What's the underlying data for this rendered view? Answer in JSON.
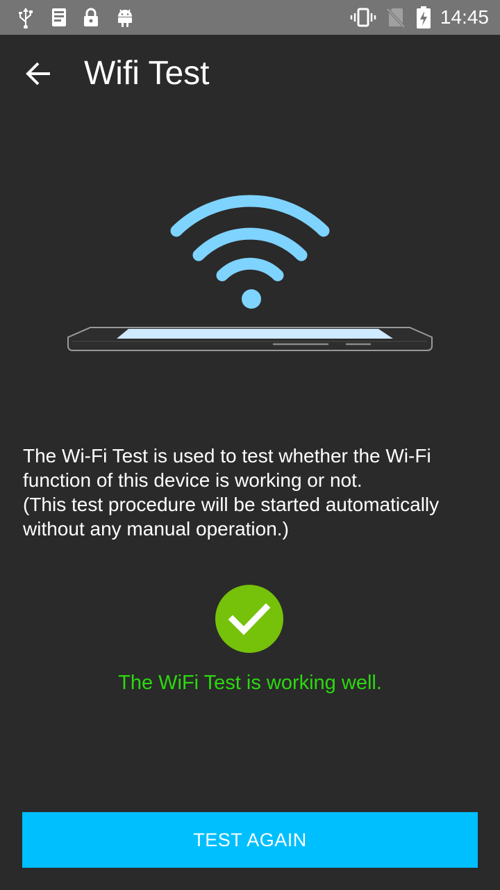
{
  "status_bar": {
    "left_icons": [
      "usb-icon",
      "log-icon",
      "lock-icon",
      "android-icon"
    ],
    "right_icons": [
      "vibrate-icon",
      "no-sim-icon",
      "battery-charging-icon"
    ],
    "time": "14:45"
  },
  "app_bar": {
    "back_icon": "arrow-back-icon",
    "title": "Wifi Test"
  },
  "illustration": {
    "icons": [
      "wifi-signal-icon",
      "phone-icon"
    ],
    "color": "#7fd3ff"
  },
  "description": {
    "line1": "The Wi-Fi Test is used to test whether the Wi-Fi function of this device is working or not.",
    "line2": "(This test procedure will be started automatically without any manual operation.)"
  },
  "result": {
    "icon": "check-circle-icon",
    "text": "The WiFi Test is working well.",
    "color": "#2bd90f"
  },
  "actions": {
    "test_again_label": "TEST AGAIN",
    "button_color": "#00bfff"
  },
  "colors": {
    "background": "#2a2a2a",
    "status_bar": "#757575"
  }
}
